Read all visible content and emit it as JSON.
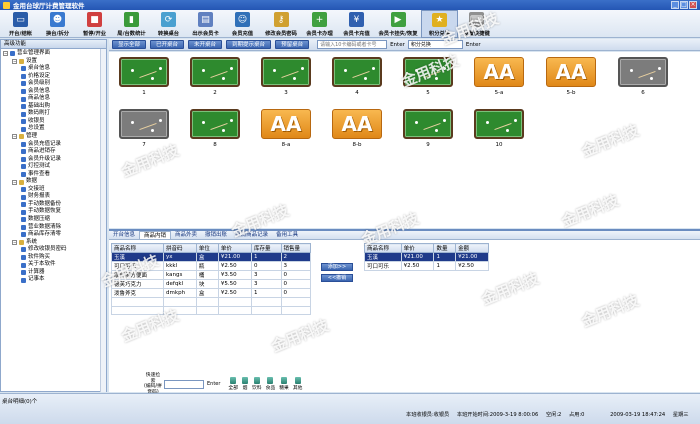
{
  "window": {
    "title": "金用台球厅计费管理软件",
    "controls": [
      "_",
      "□",
      "×"
    ]
  },
  "toolbar": [
    {
      "label": "开台/结帐",
      "icon": "monitor-icon",
      "color": "#2a5ca8",
      "glyph": "▭"
    },
    {
      "label": "换台/拆分",
      "icon": "people-icon",
      "color": "#3a7ad0",
      "glyph": "☻"
    },
    {
      "label": "暂停/开业",
      "icon": "stop-icon",
      "color": "#d04040",
      "glyph": "■"
    },
    {
      "label": "局/台数统计",
      "icon": "bar-chart-icon",
      "color": "#3a9a3a",
      "glyph": "▮"
    },
    {
      "label": "转换桌台",
      "icon": "switch-icon",
      "color": "#4aa0d0",
      "glyph": "⟳"
    },
    {
      "label": "出示会员卡",
      "icon": "card-icon",
      "color": "#6080c0",
      "glyph": "▤"
    },
    {
      "label": "会员充值",
      "icon": "member-icon",
      "color": "#3070b8",
      "glyph": "☺"
    },
    {
      "label": "修改会员密码",
      "icon": "key-icon",
      "color": "#d0a030",
      "glyph": "⚷"
    },
    {
      "label": "会员卡办理",
      "icon": "add-card-icon",
      "color": "#40a040",
      "glyph": "+"
    },
    {
      "label": "会员卡充值",
      "icon": "recharge-icon",
      "color": "#3060b0",
      "glyph": "¥"
    },
    {
      "label": "会员卡挂失/恢复",
      "icon": "play-icon",
      "color": "#40a040",
      "glyph": "▶"
    },
    {
      "label": "积分兑换",
      "icon": "star-icon",
      "color": "#e0b020",
      "glyph": "★"
    },
    {
      "label": "设置快捷键",
      "icon": "keyboard-icon",
      "color": "#909090",
      "glyph": "⌨"
    }
  ],
  "left_panel": {
    "header": "高级功能",
    "tree": [
      {
        "label": "营业管理界面",
        "level": 0,
        "exp": "−",
        "color": "#3a6fc8"
      },
      {
        "label": "设置",
        "level": 1,
        "exp": "−",
        "color": "#d8b040"
      },
      {
        "label": "桌台信息",
        "level": 2,
        "exp": "",
        "color": "#3a6fc8"
      },
      {
        "label": "价格设定",
        "level": 2,
        "exp": "",
        "color": "#3a6fc8"
      },
      {
        "label": "会员级别",
        "level": 2,
        "exp": "",
        "color": "#3a6fc8"
      },
      {
        "label": "会员信息",
        "level": 2,
        "exp": "",
        "color": "#3a6fc8"
      },
      {
        "label": "商品信息",
        "level": 2,
        "exp": "",
        "color": "#3a6fc8"
      },
      {
        "label": "基础出购",
        "level": 2,
        "exp": "",
        "color": "#3a6fc8"
      },
      {
        "label": "数码刷打",
        "level": 2,
        "exp": "",
        "color": "#3a6fc8"
      },
      {
        "label": "收银员",
        "level": 2,
        "exp": "",
        "color": "#3a6fc8"
      },
      {
        "label": "总设置",
        "level": 2,
        "exp": "",
        "color": "#3a6fc8"
      },
      {
        "label": "管理",
        "level": 1,
        "exp": "−",
        "color": "#d8b040"
      },
      {
        "label": "会员充值记录",
        "level": 2,
        "exp": "",
        "color": "#3a6fc8"
      },
      {
        "label": "商品进销存",
        "level": 2,
        "exp": "",
        "color": "#3a6fc8"
      },
      {
        "label": "会员升级记录",
        "level": 2,
        "exp": "",
        "color": "#3a6fc8"
      },
      {
        "label": "灯控测试",
        "level": 2,
        "exp": "",
        "color": "#3a6fc8"
      },
      {
        "label": "事件查看",
        "level": 2,
        "exp": "",
        "color": "#3a6fc8"
      },
      {
        "label": "数据",
        "level": 1,
        "exp": "−",
        "color": "#d8b040"
      },
      {
        "label": "交接班",
        "level": 2,
        "exp": "",
        "color": "#3a6fc8"
      },
      {
        "label": "财务报表",
        "level": 2,
        "exp": "",
        "color": "#3a6fc8"
      },
      {
        "label": "手动数据备份",
        "level": 2,
        "exp": "",
        "color": "#3a6fc8"
      },
      {
        "label": "手动数据恢复",
        "level": 2,
        "exp": "",
        "color": "#3a6fc8"
      },
      {
        "label": "数据压缩",
        "level": 2,
        "exp": "",
        "color": "#3a6fc8"
      },
      {
        "label": "营业数据清除",
        "level": 2,
        "exp": "",
        "color": "#3a6fc8"
      },
      {
        "label": "商品库存清零",
        "level": 2,
        "exp": "",
        "color": "#3a6fc8"
      },
      {
        "label": "系统",
        "level": 1,
        "exp": "−",
        "color": "#d8b040"
      },
      {
        "label": "修改收银员密码",
        "level": 2,
        "exp": "",
        "color": "#3a6fc8"
      },
      {
        "label": "软件购买",
        "level": 2,
        "exp": "",
        "color": "#3a6fc8"
      },
      {
        "label": "关于本软件",
        "level": 2,
        "exp": "",
        "color": "#3a6fc8"
      },
      {
        "label": "计算器",
        "level": 2,
        "exp": "",
        "color": "#3a6fc8"
      },
      {
        "label": "记事本",
        "level": 2,
        "exp": "",
        "color": "#3a6fc8"
      }
    ]
  },
  "filter_bar": {
    "buttons": [
      "显示全部",
      "已开桌台",
      "未开桌台",
      "到期提示桌台",
      "预留桌台"
    ],
    "card_placeholder": "请输入10卡编码或者卡号",
    "enter_label": "Enter",
    "exchange_value": "积分兑换",
    "enter2_label": "Enter"
  },
  "tables": [
    {
      "label": "1",
      "kind": "pool"
    },
    {
      "label": "2",
      "kind": "pool"
    },
    {
      "label": "3",
      "kind": "pool"
    },
    {
      "label": "4",
      "kind": "pool"
    },
    {
      "label": "5",
      "kind": "pool"
    },
    {
      "label": "5-a",
      "kind": "aa",
      "text": "AA"
    },
    {
      "label": "5-b",
      "kind": "aa",
      "text": "AA"
    },
    {
      "label": "6",
      "kind": "grey"
    },
    {
      "label": "7",
      "kind": "grey"
    },
    {
      "label": "8",
      "kind": "pool"
    },
    {
      "label": "8-a",
      "kind": "aa",
      "text": "AA"
    },
    {
      "label": "8-b",
      "kind": "aa",
      "text": "AA"
    },
    {
      "label": "9",
      "kind": "pool"
    },
    {
      "label": "10",
      "kind": "pool"
    }
  ],
  "tabs": [
    "开台信息",
    "商品内销",
    "商品外卖",
    "撤销出账",
    "撤消商品记录",
    "备用工具"
  ],
  "product_table": {
    "headers": [
      "商品名称",
      "拼音码",
      "单位",
      "单价",
      "库存量",
      "销售量"
    ],
    "rows": [
      [
        "玉溪",
        "yx",
        "盒",
        "¥21.00",
        "1",
        "2"
      ],
      [
        "可口可乐",
        "kkkl",
        "瓶",
        "¥2.50",
        "0",
        "3"
      ],
      [
        "康师傅方便面",
        "kangs",
        "桶",
        "¥3.50",
        "3",
        "0"
      ],
      [
        "德芙巧克力",
        "defqkl",
        "块",
        "¥5.50",
        "3",
        "0"
      ],
      [
        "泼鲁斧克",
        "dmkph",
        "盒",
        "¥2.50",
        "1",
        "0"
      ]
    ]
  },
  "move_buttons": {
    "add": "添加>>",
    "remove": "<<撤销"
  },
  "order_table": {
    "headers": [
      "商品名称",
      "单价",
      "数量",
      "金额"
    ],
    "rows": [
      [
        "玉溪",
        "¥21.00",
        "1",
        "¥21.00"
      ],
      [
        "可口可乐",
        "¥2.50",
        "1",
        "¥2.50"
      ]
    ]
  },
  "search_row": {
    "label_line1": "快速捡索",
    "label_line2": "(编码/拼音码)",
    "value": "",
    "enter": "Enter",
    "categories": [
      "全部",
      "烟",
      "饮料",
      "食品",
      "糖果",
      "其他"
    ]
  },
  "status": {
    "left": "桌台明细(0)个",
    "cashier": "本班收银员:收银员",
    "start_time": "本班开始时间:2009-3-19 8:00:06",
    "free": "空闲:2",
    "occupied": "占用:0",
    "datetime": "2009-03-19 18:47:24",
    "weekday": "星期三"
  },
  "watermark": "金用科技"
}
